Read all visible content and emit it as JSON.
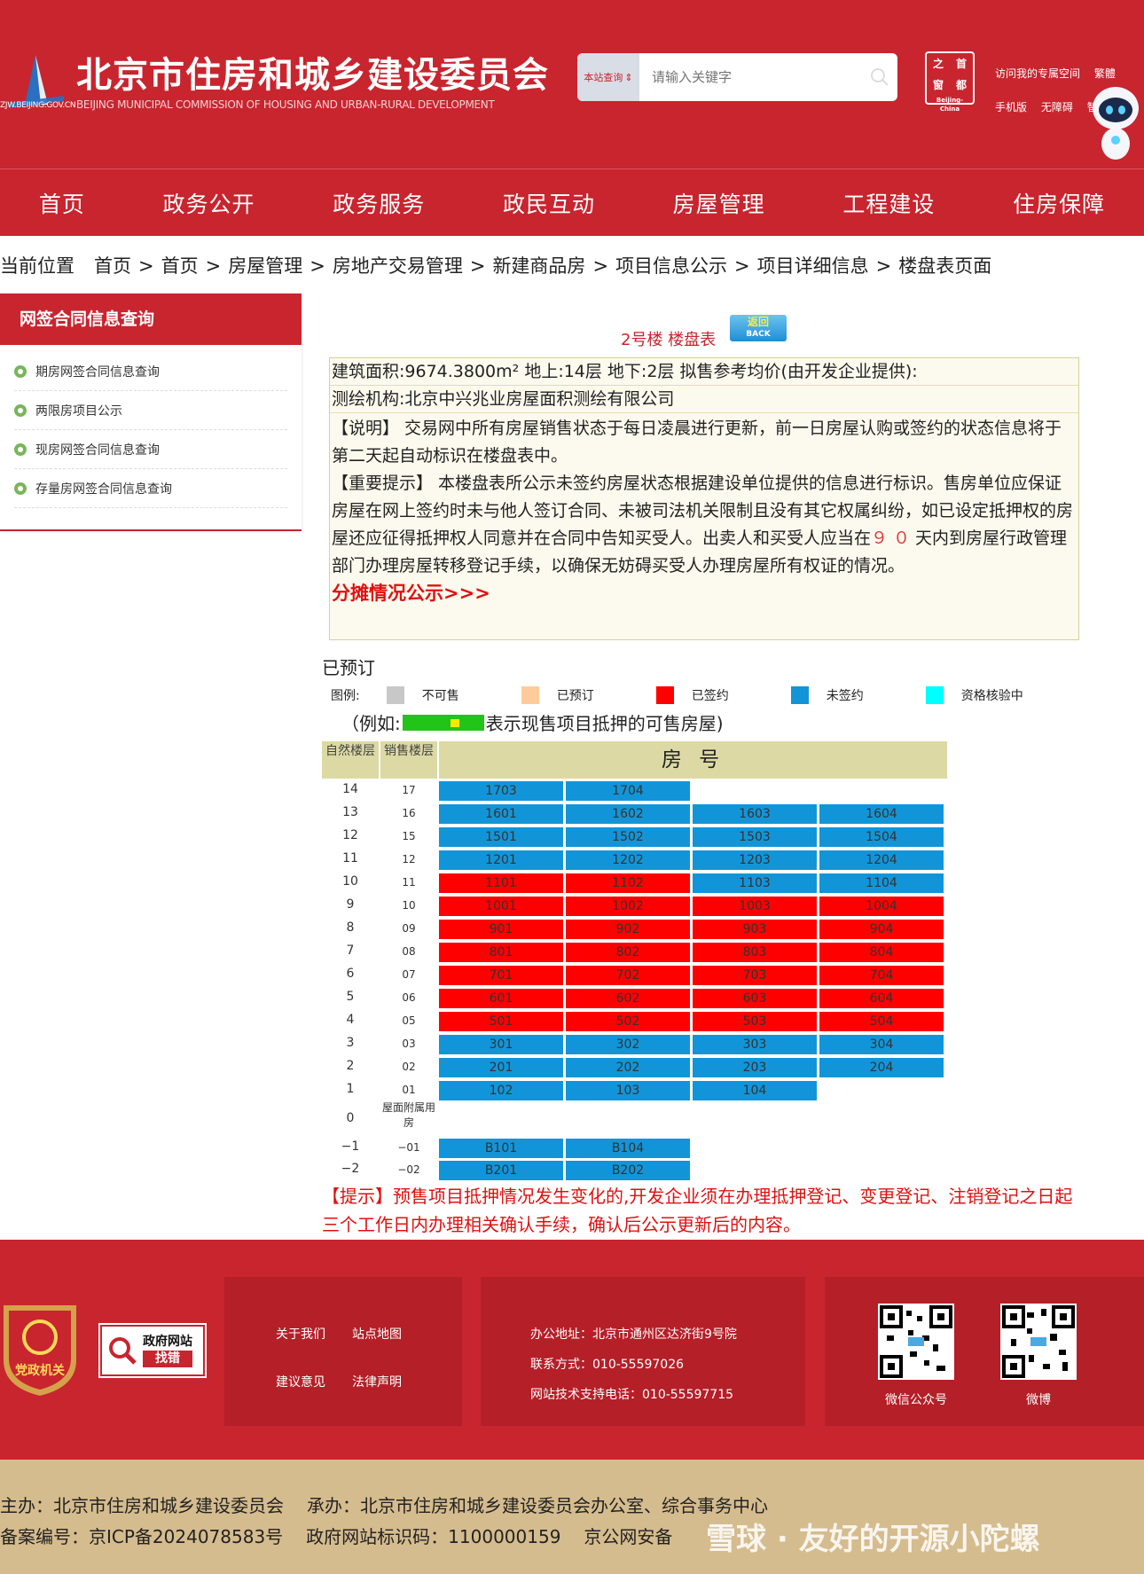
{
  "header": {
    "title": "北京市住房和城乡建设委员会",
    "subtitle": "BEIJING MUNICIPAL COMMISSION OF HOUSING AND URBAN-RURAL DEVELOPMENT",
    "logo_url_text": "ZJW.BEIJING.GOV.CN",
    "search_scope": "本站查询",
    "search_placeholder": "请输入关键字",
    "capital_logo": [
      "首",
      "之",
      "都",
      "窗",
      "Beijing-China"
    ],
    "links": [
      "访问我的专属空间",
      "繁體",
      "手机版",
      "无障碍",
      "智"
    ]
  },
  "nav": [
    "首页",
    "政务公开",
    "政务服务",
    "政民互动",
    "房屋管理",
    "工程建设",
    "住房保障"
  ],
  "breadcrumb": {
    "lead": "当前位置",
    "items": [
      "首页",
      "首页",
      "房屋管理",
      "房地产交易管理",
      "新建商品房",
      "项目信息公示",
      "项目详细信息",
      "楼盘表页面"
    ],
    "separator": ">"
  },
  "sidebar": {
    "title": "网签合同信息查询",
    "items": [
      "期房网签合同信息查询",
      "两限房项目公示",
      "现房网签合同信息查询",
      "存量房网签合同信息查询"
    ]
  },
  "building": {
    "title": "2号楼 楼盘表",
    "back_label": "返回",
    "back_en": "BACK",
    "area_line": "建筑面积:9674.3800m² 地上:14层 地下:2层 拟售参考均价(由开发企业提供):",
    "survey_line": "测绘机构:北京中兴兆业房屋面积测绘有限公司",
    "note_1": "【说明】 交易网中所有房屋销售状态于每日凌晨进行更新，前一日房屋认购或签约的状态信息将于第二天起自动标识在楼盘表中。",
    "note_2_before": "【重要提示】 本楼盘表所公示未签约房屋状态根据建设单位提供的信息进行标识。售房单位应保证房屋在网上签约时未与他人签订合同、未被司法机关限制且没有其它权属纠纷，如已设定抵押权的房屋还应征得抵押权人同意并在合同中告知买受人。出卖人和买受人应当在",
    "note_2_days": "９０",
    "note_2_after": "天内到房屋行政管理部门办理房屋转移登记手续，以确保无妨碍买受人办理房屋所有权证的情况。",
    "share_link": "分摊情况公示>>>",
    "booked_label": "已预订"
  },
  "legend": {
    "title": "图例:",
    "items": [
      {
        "label": "不可售",
        "color": "#c8c8c8"
      },
      {
        "label": "已预订",
        "color": "#ffcc99"
      },
      {
        "label": "已签约",
        "color": "#ff0000"
      },
      {
        "label": "未签约",
        "color": "#1295d8"
      },
      {
        "label": "资格核验中",
        "color": "#00ffff"
      }
    ],
    "example_prefix": "（例如:",
    "example_suffix": "表示现售项目抵押的可售房屋)"
  },
  "table": {
    "col_natural": "自然楼层",
    "col_sales": "销售楼层",
    "col_room": "房 号",
    "rows": [
      {
        "floor": "14",
        "sales": "17",
        "units": [
          [
            "1703",
            "unsigned"
          ],
          [
            "1704",
            "unsigned"
          ]
        ]
      },
      {
        "floor": "13",
        "sales": "16",
        "units": [
          [
            "1601",
            "unsigned"
          ],
          [
            "1602",
            "unsigned"
          ],
          [
            "1603",
            "unsigned"
          ],
          [
            "1604",
            "unsigned"
          ]
        ]
      },
      {
        "floor": "12",
        "sales": "15",
        "units": [
          [
            "1501",
            "unsigned"
          ],
          [
            "1502",
            "unsigned"
          ],
          [
            "1503",
            "unsigned"
          ],
          [
            "1504",
            "unsigned"
          ]
        ]
      },
      {
        "floor": "11",
        "sales": "12",
        "units": [
          [
            "1201",
            "unsigned"
          ],
          [
            "1202",
            "unsigned"
          ],
          [
            "1203",
            "unsigned"
          ],
          [
            "1204",
            "unsigned"
          ]
        ]
      },
      {
        "floor": "10",
        "sales": "11",
        "units": [
          [
            "1101",
            "signed"
          ],
          [
            "1102",
            "signed"
          ],
          [
            "1103",
            "unsigned"
          ],
          [
            "1104",
            "unsigned"
          ]
        ]
      },
      {
        "floor": "9",
        "sales": "10",
        "units": [
          [
            "1001",
            "signed"
          ],
          [
            "1002",
            "signed"
          ],
          [
            "1003",
            "signed"
          ],
          [
            "1004",
            "signed"
          ]
        ]
      },
      {
        "floor": "8",
        "sales": "09",
        "units": [
          [
            "901",
            "signed"
          ],
          [
            "902",
            "signed"
          ],
          [
            "903",
            "signed"
          ],
          [
            "904",
            "signed"
          ]
        ]
      },
      {
        "floor": "7",
        "sales": "08",
        "units": [
          [
            "801",
            "signed"
          ],
          [
            "802",
            "signed"
          ],
          [
            "803",
            "signed"
          ],
          [
            "804",
            "signed"
          ]
        ]
      },
      {
        "floor": "6",
        "sales": "07",
        "units": [
          [
            "701",
            "signed"
          ],
          [
            "702",
            "signed"
          ],
          [
            "703",
            "signed"
          ],
          [
            "704",
            "signed"
          ]
        ]
      },
      {
        "floor": "5",
        "sales": "06",
        "units": [
          [
            "601",
            "signed"
          ],
          [
            "602",
            "signed"
          ],
          [
            "603",
            "signed"
          ],
          [
            "604",
            "signed"
          ]
        ]
      },
      {
        "floor": "4",
        "sales": "05",
        "units": [
          [
            "501",
            "signed"
          ],
          [
            "502",
            "signed"
          ],
          [
            "503",
            "signed"
          ],
          [
            "504",
            "signed"
          ]
        ]
      },
      {
        "floor": "3",
        "sales": "03",
        "units": [
          [
            "301",
            "unsigned"
          ],
          [
            "302",
            "unsigned"
          ],
          [
            "303",
            "unsigned"
          ],
          [
            "304",
            "unsigned"
          ]
        ]
      },
      {
        "floor": "2",
        "sales": "02",
        "units": [
          [
            "201",
            "unsigned"
          ],
          [
            "202",
            "unsigned"
          ],
          [
            "203",
            "unsigned"
          ],
          [
            "204",
            "unsigned"
          ]
        ]
      },
      {
        "floor": "1",
        "sales": "01",
        "units": [
          [
            "102",
            "unsigned"
          ],
          [
            "103",
            "unsigned"
          ],
          [
            "104",
            "unsigned"
          ]
        ]
      },
      {
        "floor": "0",
        "sales": "屋面附属用房",
        "units": []
      },
      {
        "floor": "−1",
        "sales": "−01",
        "units": [
          [
            "B101",
            "unsigned"
          ],
          [
            "B104",
            "unsigned"
          ]
        ]
      },
      {
        "floor": "−2",
        "sales": "−02",
        "units": [
          [
            "B201",
            "unsigned"
          ],
          [
            "B202",
            "unsigned"
          ]
        ]
      }
    ]
  },
  "tip": "【提示】预售项目抵押情况发生变化的,开发企业须在办理抵押登记、变更登记、注销登记之日起三个工作日内办理相关确认手续，确认后公示更新后的内容。",
  "footer": {
    "party_badge": "党政机关",
    "gov_error": [
      "政府网站",
      "找错"
    ],
    "links": [
      "关于我们",
      "站点地图",
      "建议意见",
      "法律声明"
    ],
    "address": "办公地址：北京市通州区达济街9号院",
    "contact": "联系方式：010-55597026",
    "tech": "网站技术支持电话：010-55597715",
    "qr_labels": [
      "微信公众号",
      "微博"
    ],
    "host": "主办：北京市住房和城乡建设委员会",
    "organizer": "承办：北京市住房和城乡建设委员会办公室、综合事务中心",
    "icp": "备案编号：京ICP备2024078583号",
    "gov_id": "政府网站标识码：1100000159",
    "police": "京公网安备",
    "watermark": "雪球 · 友好的开源小陀螺"
  }
}
